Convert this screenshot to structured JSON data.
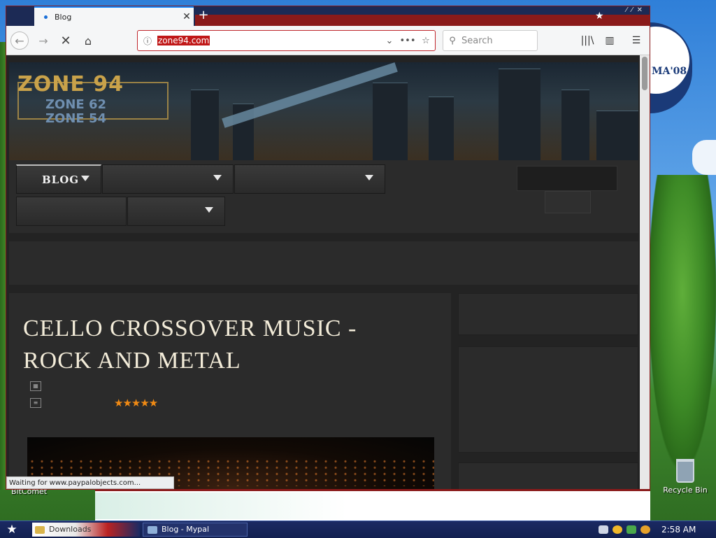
{
  "desktop": {
    "recycle_label": "Recycle Bin",
    "left_label": "BitComet",
    "badge_text": "MA'08"
  },
  "browser": {
    "tab_title": "Blog",
    "url": "zone94.com",
    "search_placeholder": "Search",
    "status_text": "Waiting for www.paypalobjects.com..."
  },
  "site": {
    "logo_main": "ZONE 94",
    "logo_sub1": "ZONE 62",
    "logo_sub2": "ZONE 54",
    "menu": [
      {
        "label": "BLOG"
      }
    ],
    "post": {
      "title": "CELLO CROSSOVER MUSIC - ROCK AND METAL",
      "rating_stars": 5,
      "rating_display": "★★★★★"
    }
  },
  "taskbar": {
    "downloads_label": "Downloads",
    "window_label": "Blog - Mypal",
    "clock": "2:58 AM"
  },
  "colors": {
    "accent_red": "#c01818",
    "star_orange": "#f08a14",
    "title_cream": "#f3ecd9",
    "logo_gold": "#c9a24a"
  }
}
